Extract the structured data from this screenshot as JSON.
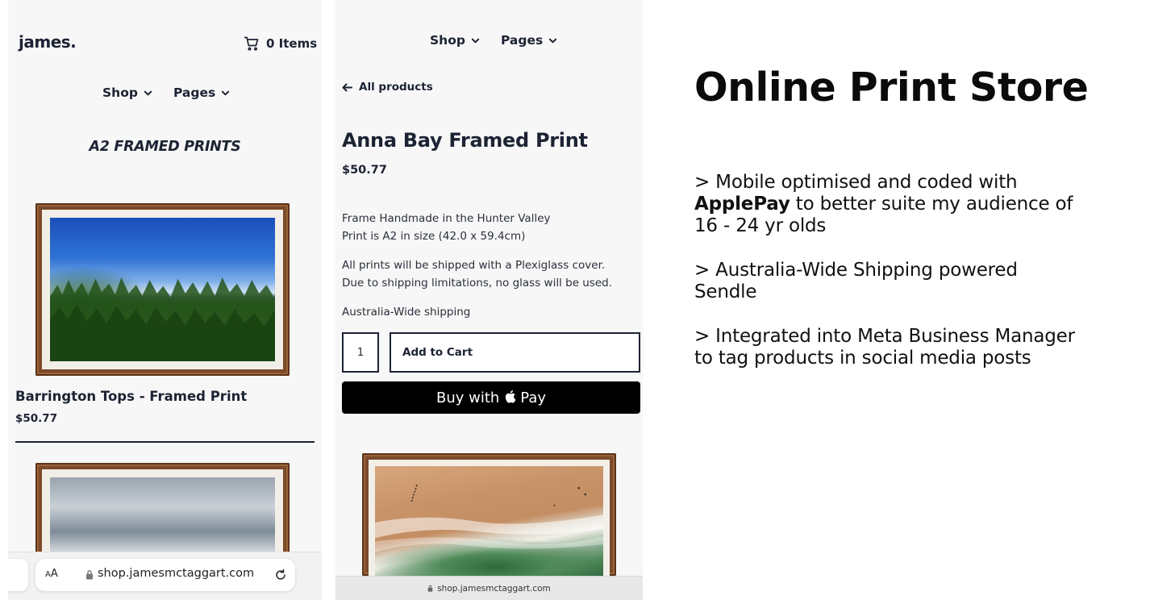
{
  "phone1": {
    "logo": "james.",
    "cart_label": "0 Items",
    "nav": [
      "Shop",
      "Pages"
    ],
    "collection_title": "A2 FRAMED PRINTS",
    "product": {
      "name": "Barrington Tops - Framed Print",
      "price": "$50.77"
    },
    "browser": {
      "aa_label_small": "A",
      "aa_label": "A",
      "url": "shop.jamesmctaggart.com"
    }
  },
  "phone2": {
    "nav": [
      "Shop",
      "Pages"
    ],
    "back_label": "All products",
    "product_title": "Anna Bay Framed Print",
    "price": "$50.77",
    "description": {
      "line1": "Frame Handmade in the Hunter Valley",
      "line2": "Print is A2 in size (42.0 x 59.4cm)",
      "line3": "All prints will be shipped with a Plexiglass cover.",
      "line4": "Due to shipping limitations, no glass will be used.",
      "line5": "Australia-Wide shipping"
    },
    "quantity": "1",
    "add_to_cart_label": "Add to Cart",
    "apple_pay_prefix": "Buy with",
    "apple_pay_suffix": "Pay",
    "url": "shop.jamesmctaggart.com"
  },
  "right": {
    "headline": "Online Print Store",
    "bullet1_part1": "> Mobile optimised and coded with ",
    "bullet1_bold": "ApplePay",
    "bullet1_part2": " to better suite my audience of 16 - 24 yr olds",
    "bullet2": "> Australia-Wide Shipping powered Sendle",
    "bullet3": "> Integrated into Meta Business Manager to tag products in social media posts"
  },
  "colors": {
    "navy": "#1c2333",
    "frame_wood": "#7b4a2a",
    "apple_pay_bg": "#000000"
  },
  "icons": [
    "cart-icon",
    "chevron-down-icon",
    "arrow-left-icon",
    "lock-icon",
    "reload-icon",
    "apple-logo-icon"
  ]
}
